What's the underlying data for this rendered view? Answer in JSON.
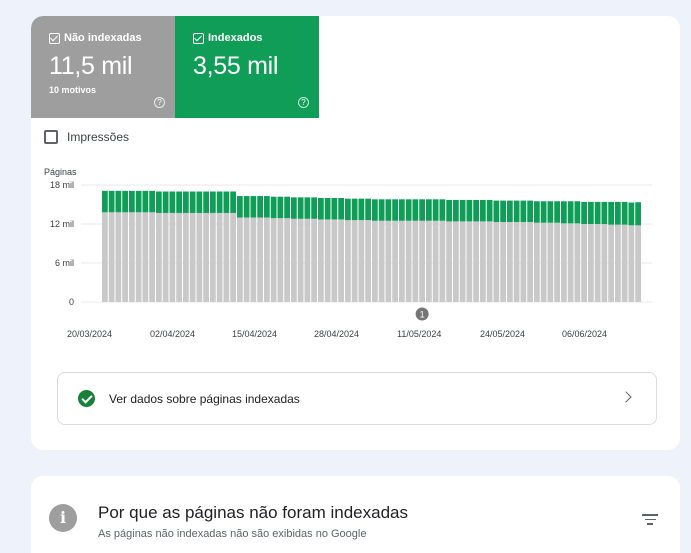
{
  "summary": {
    "not_indexed": {
      "label": "Não indexadas",
      "value": "11,5 mil",
      "sub": "10 motivos",
      "help": "?"
    },
    "indexed": {
      "label": "Indexados",
      "value": "3,55 mil",
      "help": "?"
    }
  },
  "impressions_label": "Impressões",
  "view_link": "Ver dados sobre páginas indexadas",
  "reasons": {
    "title": "Por que as páginas não foram indexadas",
    "subtitle": "As páginas não indexadas não são exibidas no Google",
    "info_glyph": "i"
  },
  "chart_data": {
    "type": "bar",
    "stacked": true,
    "ylabel": "Páginas",
    "ylim": [
      0,
      18000
    ],
    "yticks": [
      0,
      6000,
      12000,
      18000
    ],
    "ytick_labels": [
      "0",
      "6 mil",
      "12 mil",
      "18 mil"
    ],
    "xtick_labels": [
      "20/03/2024",
      "02/04/2024",
      "15/04/2024",
      "28/04/2024",
      "11/05/2024",
      "24/05/2024",
      "06/06/2024"
    ],
    "annotation": {
      "text": "1",
      "bar_index": 47
    },
    "colors": {
      "not_indexed": "#c9c9c9",
      "indexed": "#0f9d58"
    },
    "series": [
      {
        "name": "Não indexadas",
        "values": [
          13800,
          13800,
          13800,
          13800,
          13800,
          13800,
          13800,
          13800,
          13700,
          13700,
          13700,
          13700,
          13700,
          13700,
          13700,
          13700,
          13700,
          13700,
          13700,
          13700,
          13000,
          13000,
          13000,
          13000,
          13000,
          12900,
          12900,
          12900,
          12800,
          12800,
          12800,
          12800,
          12700,
          12700,
          12700,
          12700,
          12600,
          12600,
          12600,
          12600,
          12500,
          12500,
          12500,
          12500,
          12500,
          12500,
          12500,
          12500,
          12500,
          12500,
          12500,
          12400,
          12400,
          12400,
          12400,
          12400,
          12400,
          12400,
          12300,
          12300,
          12300,
          12300,
          12300,
          12300,
          12200,
          12200,
          12200,
          12200,
          12100,
          12100,
          12100,
          12000,
          12000,
          12000,
          12000,
          11900,
          11900,
          11900,
          11800,
          11800
        ]
      },
      {
        "name": "Indexados",
        "values": [
          3300,
          3300,
          3300,
          3300,
          3300,
          3300,
          3300,
          3300,
          3300,
          3300,
          3300,
          3300,
          3300,
          3300,
          3300,
          3300,
          3300,
          3300,
          3300,
          3300,
          3300,
          3300,
          3300,
          3300,
          3300,
          3300,
          3300,
          3300,
          3300,
          3300,
          3300,
          3300,
          3300,
          3300,
          3300,
          3300,
          3300,
          3300,
          3300,
          3300,
          3300,
          3300,
          3300,
          3300,
          3300,
          3300,
          3300,
          3300,
          3300,
          3300,
          3300,
          3300,
          3300,
          3300,
          3300,
          3300,
          3300,
          3300,
          3300,
          3300,
          3300,
          3300,
          3300,
          3300,
          3300,
          3300,
          3300,
          3300,
          3400,
          3400,
          3400,
          3400,
          3400,
          3400,
          3400,
          3500,
          3500,
          3500,
          3500,
          3550
        ]
      }
    ]
  }
}
